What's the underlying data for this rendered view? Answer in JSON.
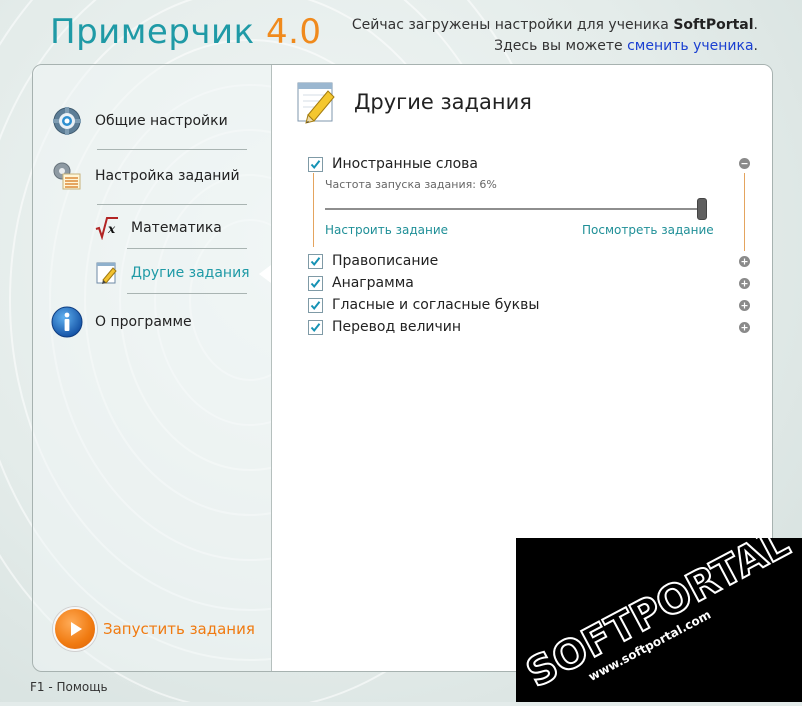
{
  "app": {
    "title": "Примерчик",
    "version": "4.0"
  },
  "header": {
    "line1_prefix": "Сейчас загружены настройки для ученика ",
    "student_name": "SoftPortal",
    "line1_suffix": ".",
    "line2_prefix": "Здесь вы можете ",
    "change_link": "сменить ученика",
    "line2_suffix": "."
  },
  "sidebar": {
    "items": [
      {
        "label": "Общие настройки",
        "icon": "gear-icon"
      },
      {
        "label": "Настройка заданий",
        "icon": "gears-table-icon"
      },
      {
        "label": "Математика",
        "icon": "sqrt-x-icon"
      },
      {
        "label": "Другие задания",
        "icon": "pencil-note-icon"
      },
      {
        "label": "О программе",
        "icon": "info-icon"
      }
    ],
    "active_item": "Другие задания",
    "run_button": "Запустить задания"
  },
  "content": {
    "section_title": "Другие задания",
    "tasks": [
      {
        "label": "Иностранные слова",
        "checked": true,
        "expanded": true
      },
      {
        "label": "Правописание",
        "checked": true,
        "expanded": false
      },
      {
        "label": "Анаграмма",
        "checked": true,
        "expanded": false
      },
      {
        "label": "Гласные и согласные буквы",
        "checked": true,
        "expanded": false
      },
      {
        "label": "Перевод величин",
        "checked": true,
        "expanded": false
      }
    ],
    "frequency_label": "Частота запуска задания: 6%",
    "frequency_percent": 6,
    "configure_link": "Настроить задание",
    "view_link": "Посмотреть задание"
  },
  "footer": {
    "help": "F1 - Помощь"
  },
  "colors": {
    "accent_teal": "#1f9aa6",
    "accent_orange": "#f08a1c",
    "link_blue": "#1a3fd1"
  }
}
